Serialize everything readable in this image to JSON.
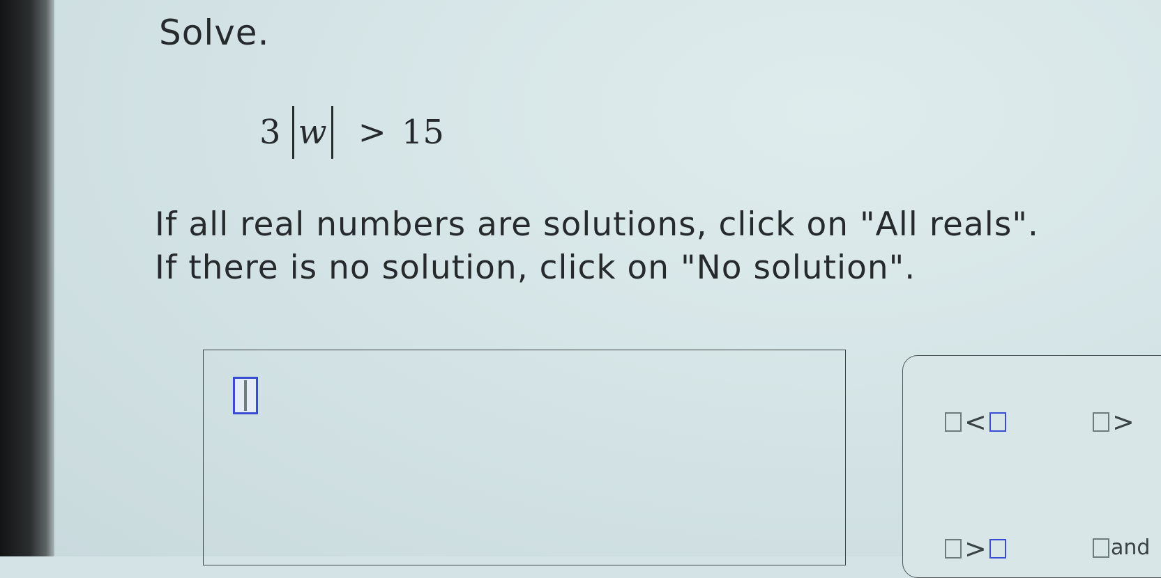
{
  "question": {
    "title": "Solve.",
    "equation": {
      "coefficient": "3",
      "variable": "w",
      "relation": ">",
      "rhs": "15"
    },
    "instructions": [
      "If all real numbers are solutions, click on \"All reals\".",
      "If there is no solution, click on \"No solution\"."
    ]
  },
  "palette": {
    "tools": [
      {
        "name": "less-than-tool",
        "op": "<"
      },
      {
        "name": "greater-than-tool",
        "op": ">"
      },
      {
        "name": "greater-or-equal-tool",
        "op": ">"
      },
      {
        "name": "and-tool",
        "word": "and"
      }
    ]
  },
  "colors": {
    "accent": "#3a4cd4",
    "text": "#262a2c",
    "background": "#d4e4e6"
  }
}
